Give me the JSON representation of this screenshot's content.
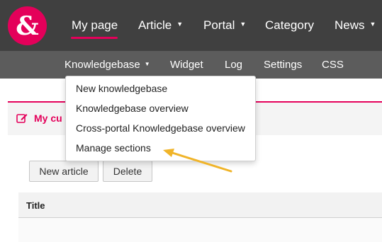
{
  "logo": {
    "glyph": "&",
    "color": "#e4005a"
  },
  "mainnav": {
    "items": [
      {
        "label": "My page",
        "active": true
      },
      {
        "label": "Article",
        "caret": "▼"
      },
      {
        "label": "Portal",
        "caret": "▼"
      },
      {
        "label": "Category"
      },
      {
        "label": "News",
        "caret": "▼"
      }
    ]
  },
  "subnav": {
    "items": [
      {
        "label": "Knowledgebase",
        "caret": "▼"
      },
      {
        "label": "Widget"
      },
      {
        "label": "Log"
      },
      {
        "label": "Settings"
      },
      {
        "label": "CSS"
      }
    ]
  },
  "dropdown": {
    "items": [
      {
        "label": "New knowledgebase"
      },
      {
        "label": "Knowledgebase overview"
      },
      {
        "label": "Cross-portal Knowledgebase overview"
      },
      {
        "label": "Manage sections"
      }
    ]
  },
  "section": {
    "title": "My cu"
  },
  "toolbar": {
    "new_article": "New article",
    "delete": "Delete"
  },
  "table": {
    "columns": [
      "Title"
    ]
  },
  "colors": {
    "accent": "#e4005a",
    "topbar": "#404040",
    "subbar": "#5c5c5c",
    "annotation_arrow": "#f0b429"
  }
}
